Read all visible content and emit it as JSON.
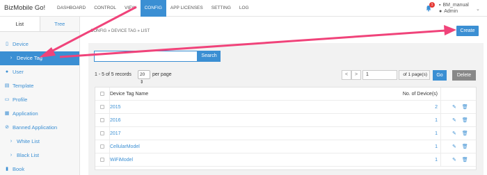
{
  "brand": "BizMobile Go!",
  "nav": [
    "DASHBOARD",
    "CONTROL",
    "VIEW",
    "CONFIG",
    "APP LICENSES",
    "SETTING",
    "LOG"
  ],
  "nav_active": "CONFIG",
  "notification_count": "1",
  "user": {
    "name": "BM_manual",
    "role": "Admin"
  },
  "sidebar": {
    "tabs": [
      "List",
      "Tree"
    ],
    "items": [
      {
        "icon": "tablet-icon",
        "label": "Device"
      },
      {
        "icon": "chevron-right-icon",
        "label": "Device Tag"
      },
      {
        "icon": "user-icon",
        "label": "User"
      },
      {
        "icon": "file-icon",
        "label": "Template"
      },
      {
        "icon": "profile-icon",
        "label": "Profile"
      },
      {
        "icon": "grid-icon",
        "label": "Application"
      },
      {
        "icon": "ban-icon",
        "label": "Banned Application"
      },
      {
        "icon": "chevron-right-icon",
        "label": "White List"
      },
      {
        "icon": "chevron-right-icon",
        "label": "Black List"
      },
      {
        "icon": "book-icon",
        "label": "Book"
      }
    ]
  },
  "breadcrumb": "CONFIG » DEVICE TAG » LIST",
  "create_label": "Create",
  "search": {
    "placeholder": "",
    "button": "Search"
  },
  "records_label": "1 - 5 of 5 records",
  "per_page_value": "20",
  "per_page_label": "per page",
  "pagination": {
    "prev": "<",
    "next": ">",
    "page": "1",
    "of_label": "of 1 page(s)",
    "go": "Go",
    "delete": "Delete"
  },
  "table": {
    "headers": [
      "Device Tag Name",
      "No. of Device(s)"
    ],
    "rows": [
      {
        "name": "2015",
        "count": "2"
      },
      {
        "name": "2016",
        "count": "1"
      },
      {
        "name": "2017",
        "count": "1"
      },
      {
        "name": "CellularModel",
        "count": "1"
      },
      {
        "name": "WiFiModel",
        "count": "1"
      }
    ]
  },
  "colors": {
    "accent": "#3b8fd3",
    "arrow": "#f0437a",
    "badge": "#e53935"
  }
}
